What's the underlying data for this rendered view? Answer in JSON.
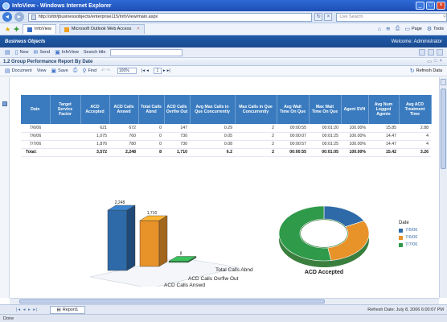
{
  "window": {
    "title": "InfoView - Windows Internet Explorer",
    "minimize": "_",
    "maximize": "□",
    "close": "×"
  },
  "address": {
    "url": "http://sfdr/jbusinessobjects/enterprise115/InfoView/main.aspx",
    "search_placeholder": "Live Search"
  },
  "tabs": [
    {
      "label": "InfoView"
    },
    {
      "label": "Microsoft Outlook Web Access"
    }
  ],
  "command_bar": {
    "page_label": "Page",
    "tools_label": "Tools"
  },
  "app": {
    "logo": "Business Objects",
    "welcome": "Welcome: Administrator"
  },
  "app_toolbar": {
    "new_label": "New",
    "send_label": "Send",
    "infoview_label": "InfoView",
    "search_label": "Search title"
  },
  "report": {
    "title": "1.2 Group Performance Report By Date",
    "toolbar": {
      "document": "Document",
      "view": "View",
      "save": "Save",
      "find": "Find",
      "zoom": "100%",
      "page": "1",
      "refresh": "Refresh Data"
    }
  },
  "table": {
    "headers": [
      "Date",
      "Target Service Factor",
      "ACD Accepted",
      "ACD Calls Answd",
      "Total Calls Abnd",
      "ACD Calls Ovrflw Out",
      "Avg Max Calls in Que Concurrently",
      "Max Calls in Que Concurrently",
      "Avg Wait Time On Que",
      "Max Wait Time On Que",
      "Agent SVH",
      "Avg Num Logged Agents",
      "Avg ACD Treatment Time"
    ],
    "rows": [
      [
        "7/6/06",
        "",
        "621",
        "672",
        "0",
        "147",
        "0.29",
        "2",
        "00:00:55",
        "00:01:20",
        "100.00%",
        "15.85",
        "2.88"
      ],
      [
        "7/6/06",
        "",
        "1,075",
        "760",
        "0",
        "730",
        "0.05",
        "2",
        "00:00:07",
        "00:01:25",
        "100.00%",
        "14.47",
        "4"
      ],
      [
        "7/7/06",
        "",
        "1,876",
        "780",
        "0",
        "730",
        "0.08",
        "2",
        "00:00:57",
        "00:01:25",
        "100.00%",
        "14.47",
        "4"
      ]
    ],
    "total": [
      "Total:",
      "",
      "3,572",
      "2,248",
      "8",
      "1,710",
      "6.2",
      "2",
      "00:00:55",
      "00:01:05",
      "100.00%",
      "15.42",
      "3.26"
    ]
  },
  "bar_chart": {
    "labels_on_bars": [
      "2,248",
      "1,710",
      "8"
    ],
    "axis_labels": [
      "Total Calls Abnd",
      "ACD Calls Ovrflw Out",
      "ACD Calls Answd"
    ]
  },
  "chart_data": [
    {
      "type": "bar",
      "categories": [
        "ACD Calls Answd",
        "ACD Calls Ovrflw Out",
        "Total Calls Abnd"
      ],
      "values": [
        2248,
        1710,
        8
      ],
      "title": "",
      "xlabel": "",
      "ylabel": ""
    },
    {
      "type": "pie",
      "title": "ACD Accepted",
      "categories": [
        "7/6/06",
        "7/6/06",
        "7/7/06"
      ],
      "values": [
        621,
        1075,
        1876
      ],
      "legend_title": "Date",
      "colors": [
        "#2e6aa8",
        "#e8922a",
        "#2f9a4a"
      ]
    }
  ],
  "pie": {
    "label": "ACD Accepted",
    "legend_title": "Date",
    "legend": [
      "7/6/06",
      "7/6/06",
      "7/7/06"
    ]
  },
  "bottom": {
    "sheet_tab": "Report1",
    "refresh_date": "Refresh Date: July 8, 2006 6:00:07 PM",
    "nav_arrows": "|◂ ◂ ▸ ▸|",
    "status": "Done"
  },
  "colors": {
    "header_blue": "#3a7bbf",
    "bar_blue": "#2e6aa8",
    "bar_orange": "#e8922a",
    "bar_green": "#2f9a4a"
  }
}
